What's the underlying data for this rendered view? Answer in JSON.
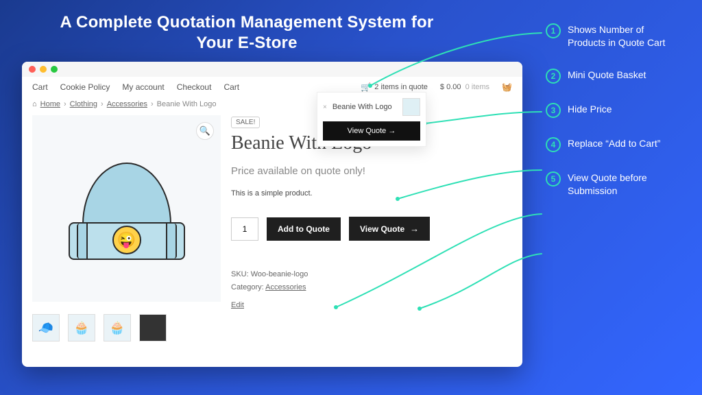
{
  "hero_title": "A Complete Quotation Management System for Your E-Store",
  "annotations": [
    "Shows Number of Products in Quote Cart",
    "Mini Quote Basket",
    "Hide Price",
    "Replace “Add to Cart”",
    "View Quote before Submission"
  ],
  "nav": {
    "items": [
      "Cart",
      "Cookie Policy",
      "My account",
      "Checkout",
      "Cart"
    ],
    "quote_summary": "2 items in quote",
    "cart_price": "$ 0.00",
    "cart_items": "0 items"
  },
  "breadcrumb": {
    "home": "Home",
    "clothing": "Clothing",
    "accessories": "Accessories",
    "current": "Beanie With Logo"
  },
  "mini_basket": {
    "item_label": "Beanie With Logo",
    "view_label": "View Quote"
  },
  "product": {
    "sale_label": "SALE!",
    "zoom_label": "🔍",
    "title": "Beanie With Logo",
    "price_message": "Price available on quote only!",
    "description": "This is a simple product.",
    "qty": "1",
    "add_label": "Add to Quote",
    "view_label": "View Quote",
    "sku_prefix": "SKU: ",
    "sku": "Woo-beanie-logo",
    "category_prefix": "Category: ",
    "category": "Accessories",
    "edit_label": "Edit"
  },
  "thumbs": {
    "t4_label": ""
  }
}
